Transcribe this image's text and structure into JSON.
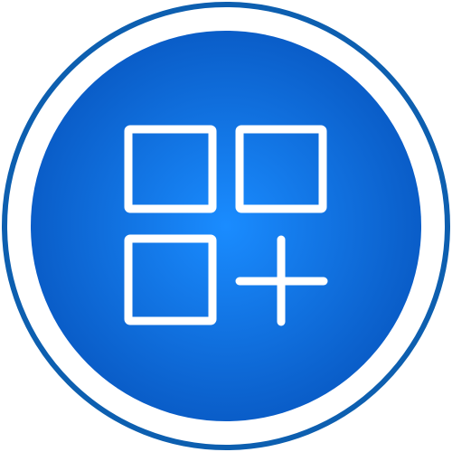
{
  "icon": {
    "name": "add-widget-icon",
    "colors": {
      "outer_ring": "#0D5FB0",
      "background": "#FFFFFF",
      "fill_center": "#1A8CFF",
      "fill_edge": "#0A5DC8",
      "glyph": "#FFFFFF"
    }
  }
}
